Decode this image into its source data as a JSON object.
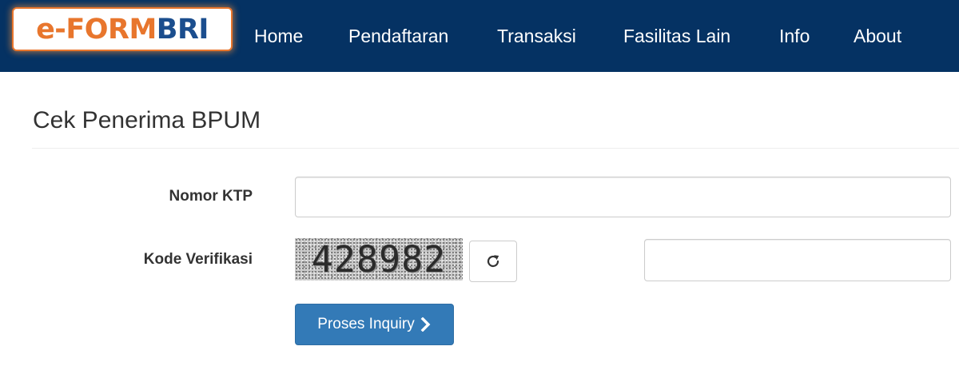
{
  "navbar": {
    "logo": {
      "part1": "e-FORM",
      "part2": "BRI"
    },
    "items": [
      {
        "label": "Home"
      },
      {
        "label": "Pendaftaran"
      },
      {
        "label": "Transaksi"
      },
      {
        "label": "Fasilitas Lain"
      },
      {
        "label": "Info"
      },
      {
        "label": "About"
      }
    ]
  },
  "page": {
    "title": "Cek Penerima BPUM"
  },
  "form": {
    "ktp_label": "Nomor KTP",
    "ktp_value": "",
    "verification_label": "Kode Verifikasi",
    "captcha_text": "428982",
    "verification_value": "",
    "refresh_icon": "refresh-icon",
    "submit_label": "Proses Inquiry",
    "submit_icon": "chevron-right-icon"
  },
  "colors": {
    "navbar_bg": "#053263",
    "logo_orange": "#e8762d",
    "logo_blue": "#1b4e8e",
    "primary_button": "#337ab7"
  }
}
